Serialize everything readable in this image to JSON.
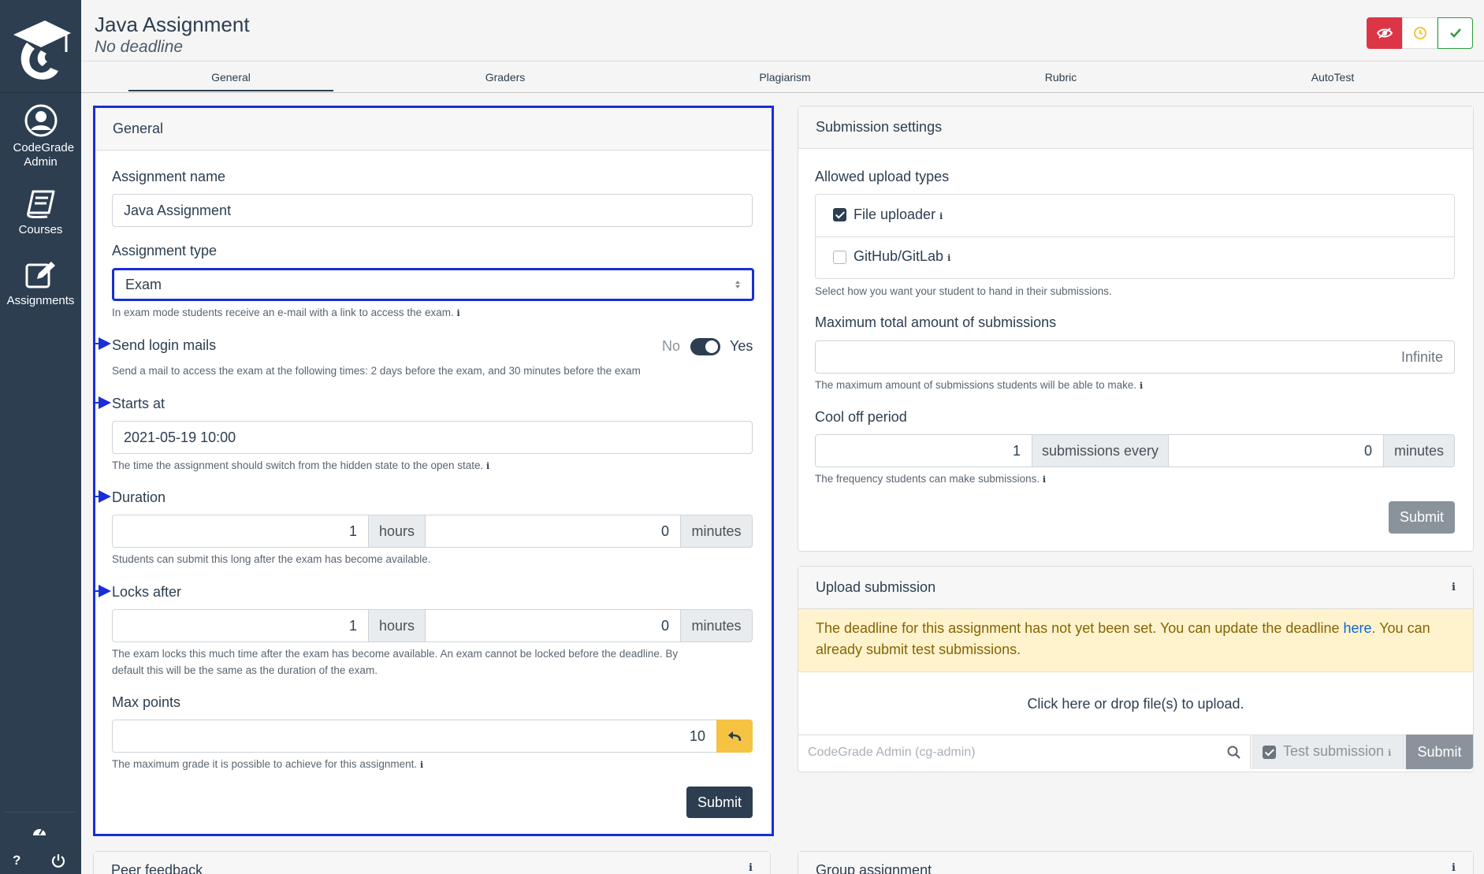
{
  "sidebar": {
    "items": [
      {
        "label": "CodeGrade Admin"
      },
      {
        "label": "Courses"
      },
      {
        "label": "Assignments"
      }
    ],
    "help_label": "?"
  },
  "header": {
    "title": "Java Assignment",
    "subtitle": "No deadline",
    "tabs": [
      "General",
      "Graders",
      "Plagiarism",
      "Rubric",
      "AutoTest"
    ],
    "active_tab": "General"
  },
  "general": {
    "title": "General",
    "assignment_name_label": "Assignment name",
    "assignment_name_value": "Java Assignment",
    "assignment_type_label": "Assignment type",
    "assignment_type_value": "Exam",
    "assignment_type_help": "In exam mode students receive an e-mail with a link to access the exam.",
    "send_login_label": "Send login mails",
    "toggle_no": "No",
    "toggle_yes": "Yes",
    "send_login_help": "Send a mail to access the exam at the following times: 2 days before the exam, and 30 minutes before the exam",
    "starts_at_label": "Starts at",
    "starts_at_value": "2021-05-19 10:00",
    "starts_at_help": "The time the assignment should switch from the hidden state to the open state.",
    "duration_label": "Duration",
    "duration_hours": "1",
    "duration_minutes": "0",
    "hours_unit": "hours",
    "minutes_unit": "minutes",
    "duration_help": "Students can submit this long after the exam has become available.",
    "locks_after_label": "Locks after",
    "locks_hours": "1",
    "locks_minutes": "0",
    "locks_help_1": "The exam locks this much time after the exam has become available. An exam cannot be locked before the deadline. By",
    "locks_help_2": "default this will be the same as the duration of the exam.",
    "max_points_label": "Max points",
    "max_points_value": "10",
    "max_points_help": "The maximum grade it is possible to achieve for this assignment.",
    "submit_label": "Submit"
  },
  "submission_settings": {
    "title": "Submission settings",
    "upload_types_label": "Allowed upload types",
    "file_uploader_label": "File uploader",
    "file_uploader_checked": true,
    "github_label": "GitHub/GitLab",
    "github_checked": false,
    "upload_types_help": "Select how you want your student to hand in their submissions.",
    "max_submissions_label": "Maximum total amount of submissions",
    "max_submissions_placeholder": "Infinite",
    "max_submissions_help": "The maximum amount of submissions students will be able to make.",
    "cool_off_label": "Cool off period",
    "cool_off_count": "1",
    "cool_off_middle": "submissions every",
    "cool_off_minutes": "0",
    "minutes_unit": "minutes",
    "cool_off_help": "The frequency students can make submissions.",
    "submit_label": "Submit"
  },
  "upload_submission": {
    "title": "Upload submission",
    "warning_text_1": "The deadline for this assignment has not yet been set. You can update the deadline ",
    "warning_link": "here",
    "warning_text_2": ". You can",
    "warning_text_3": "already submit test submissions.",
    "drop_text": "Click here or drop file(s) to upload.",
    "user_placeholder": "CodeGrade Admin (cg-admin)",
    "test_submission_label": "Test submission",
    "submit_label": "Submit"
  },
  "bottom_cards": {
    "peer_feedback": "Peer feedback",
    "group_assignment": "Group assignment"
  },
  "colors": {
    "sidebar": "#2c3e50",
    "highlight": "#1a2ed6",
    "danger": "#dc3545",
    "warning": "#f5c242",
    "success": "#2e9e3e"
  }
}
